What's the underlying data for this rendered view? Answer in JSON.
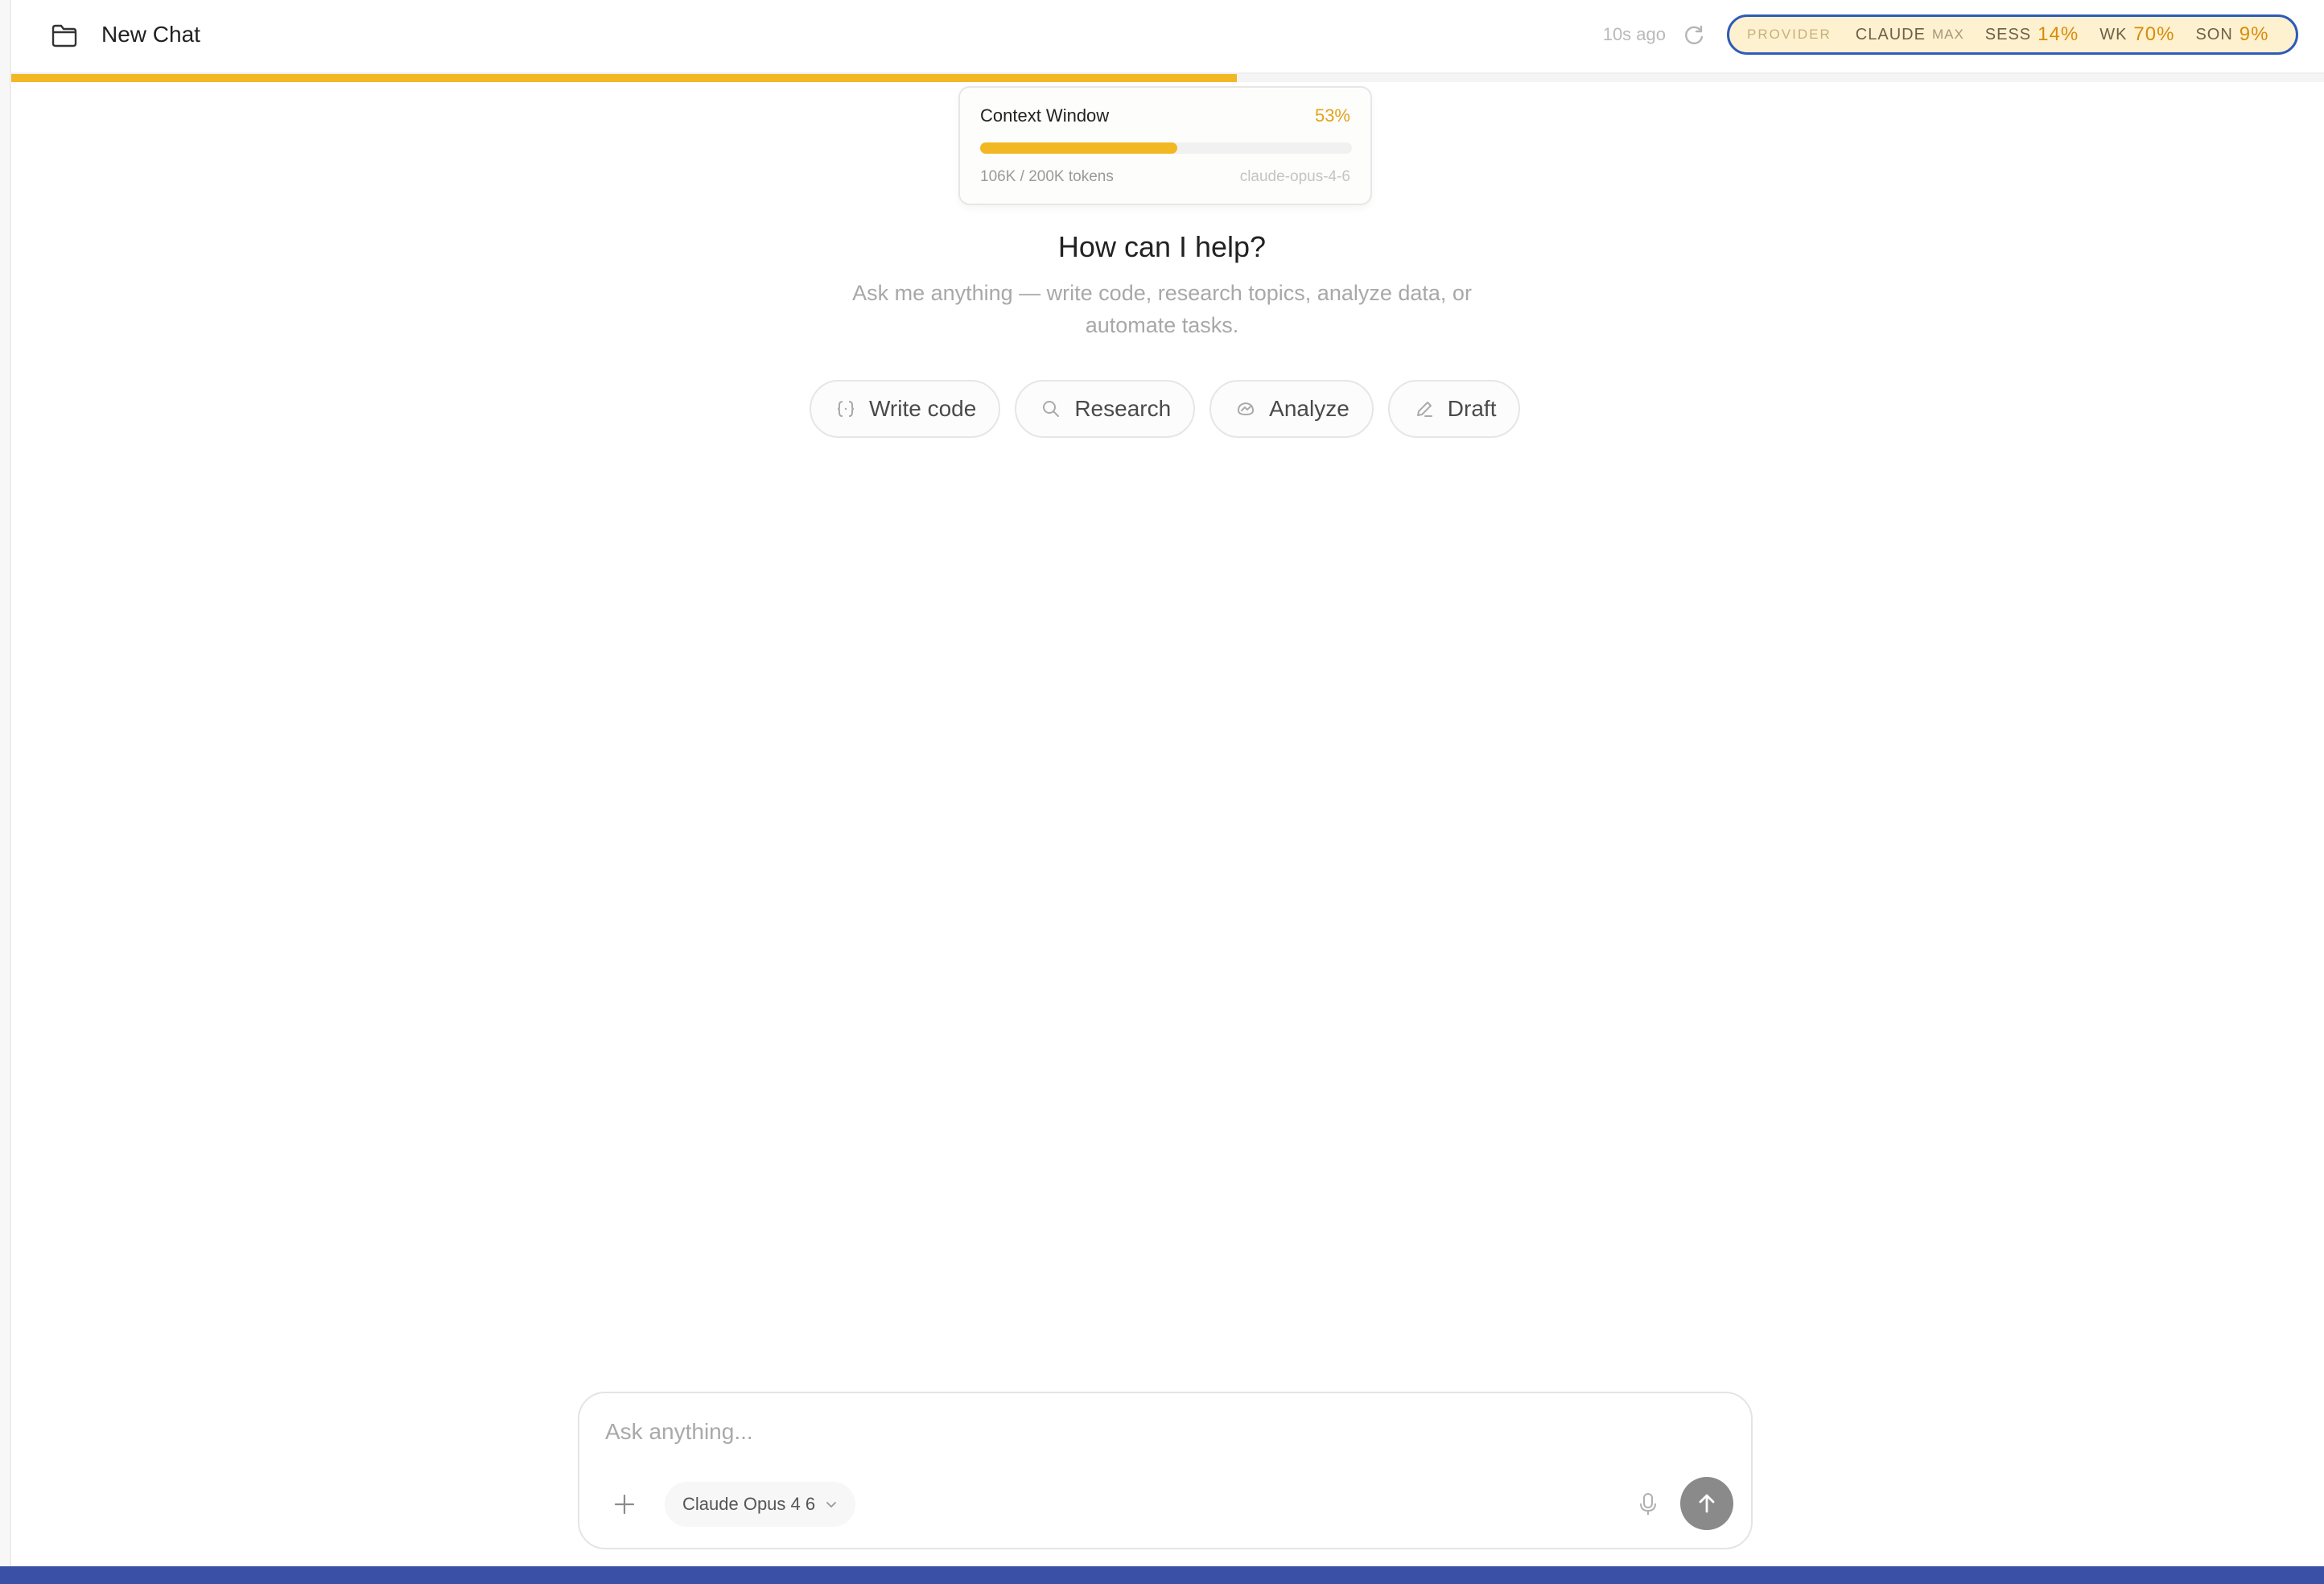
{
  "header": {
    "title": "New Chat",
    "updated_ago": "10s ago",
    "folder_icon": "folder-icon",
    "refresh_icon": "refresh-icon"
  },
  "provider": {
    "label": "PROVIDER",
    "name": "CLAUDE",
    "tier": "MAX",
    "sess_label": "SESS",
    "sess_value": "14%",
    "wk_label": "WK",
    "wk_value": "70%",
    "son_label": "SON",
    "son_value": "9%"
  },
  "context": {
    "title": "Context Window",
    "percent_label": "53%",
    "fraction": 0.53,
    "tokens": "106K / 200K tokens",
    "model": "claude-opus-4-6"
  },
  "welcome": {
    "heading": "How can I help?",
    "subtitle": "Ask me anything — write code, research topics, analyze data, or automate tasks."
  },
  "suggestions": [
    {
      "label": "Write code",
      "icon": "braces-icon"
    },
    {
      "label": "Research",
      "icon": "search-icon"
    },
    {
      "label": "Analyze",
      "icon": "chart-icon"
    },
    {
      "label": "Draft",
      "icon": "pencil-icon"
    }
  ],
  "composer": {
    "placeholder": "Ask anything...",
    "value": "",
    "model_label": "Claude Opus 4 6"
  },
  "colors": {
    "accent": "#f2b824",
    "provider_border": "#2e5bb8",
    "provider_bg": "#fdf1cf",
    "percent_text": "#e3a21a",
    "send_button": "#8a8a8a",
    "bottom_band": "#3a4fa6"
  }
}
